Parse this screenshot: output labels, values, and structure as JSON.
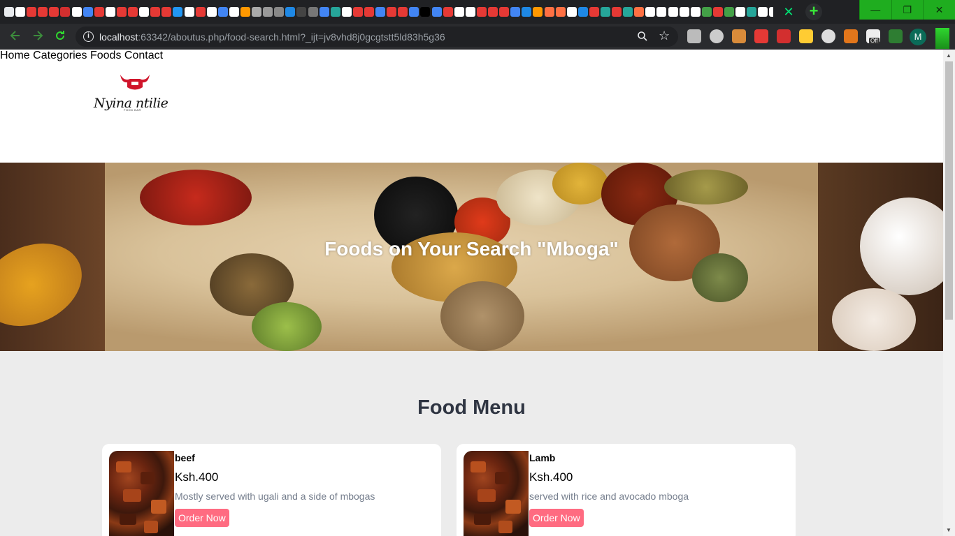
{
  "browser": {
    "url_host": "localhost",
    "url_rest": ":63342/aboutus.php/food-search.html?_ijt=jv8vhd8j0gcgtstt5ld83h5g36",
    "tab_close": "✕",
    "new_tab": "+",
    "window_controls": [
      "—",
      "❐",
      "✕"
    ],
    "avatar_letter": "M",
    "extension_badge": "Off",
    "accent_color": "#1fad1f"
  },
  "site": {
    "logo_text": "Nyina ntilie",
    "logo_sub": "FOOD BAR",
    "nav": [
      {
        "label": "Home"
      },
      {
        "label": "Categories"
      },
      {
        "label": "Foods"
      },
      {
        "label": "Contact"
      }
    ],
    "hero_title": "Foods on Your Search \"Mboga\"",
    "menu_title": "Food Menu",
    "accent_color": "#ff6b81",
    "foods": [
      {
        "name": "beef",
        "price": "Ksh.400",
        "description": "Mostly served with ugali and a side of mbogas",
        "button": "Order Now"
      },
      {
        "name": "Lamb",
        "price": "Ksh.400",
        "description": "served with rice and avocado mboga",
        "button": "Order Now"
      }
    ]
  }
}
